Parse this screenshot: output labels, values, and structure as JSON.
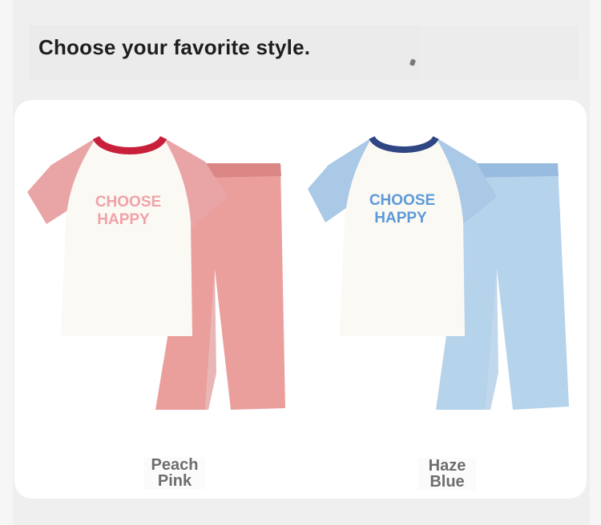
{
  "header": {
    "title": "Choose your favorite style."
  },
  "products": [
    {
      "id": "peach-pink",
      "label_line1": "Peach",
      "label_line2": "Pink",
      "graphic_text_line1": "CHOOSE",
      "graphic_text_line2": "HAPPY",
      "colors": {
        "sleeve": "#e9a5a6",
        "pants": "#ea9f9d",
        "pants_shadow": "#d98684",
        "collar": "#c8203a",
        "graphic": "#f0a2a8",
        "shirt": "#fbf9f4"
      }
    },
    {
      "id": "haze-blue",
      "label_line1": "Haze",
      "label_line2": "Blue",
      "graphic_text_line1": "CHOOSE",
      "graphic_text_line2": "HAPPY",
      "colors": {
        "sleeve": "#a9c9e6",
        "pants": "#b6d3ec",
        "pants_shadow": "#98bcdf",
        "collar": "#2f4684",
        "graphic": "#5e9ad8",
        "shirt": "#fbf9f4"
      }
    }
  ]
}
